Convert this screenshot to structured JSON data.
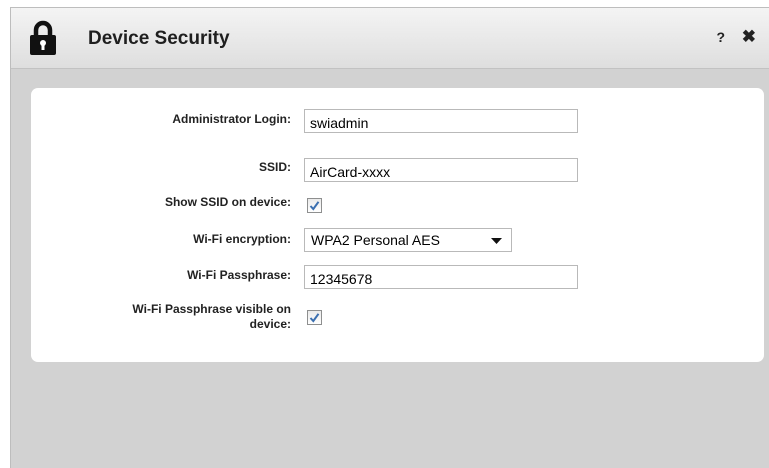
{
  "window": {
    "title": "Device Security",
    "help_label": "?",
    "close_label": "✖"
  },
  "icons": {
    "title_icon": "lock-icon",
    "help": "help-icon",
    "close": "close-icon",
    "checkbox_mark": "check-icon",
    "dropdown": "chevron-down-icon"
  },
  "form": {
    "admin_login": {
      "label": "Administrator Login:",
      "value": "swiadmin"
    },
    "ssid": {
      "label": "SSID:",
      "value": "AirCard-xxxx"
    },
    "show_ssid": {
      "label": "Show SSID on device:",
      "checked": true
    },
    "encryption": {
      "label": "Wi-Fi encryption:",
      "selected": "WPA2 Personal AES"
    },
    "passphrase": {
      "label": "Wi-Fi Passphrase:",
      "value": "12345678"
    },
    "passphrase_visible": {
      "label_line1": "Wi-Fi Passphrase visible on",
      "label_line2": "device:",
      "checked": true
    }
  },
  "colors": {
    "dialog_bg": "#d2d2d2",
    "panel_bg": "#ffffff",
    "check_color": "#3b6fb0"
  }
}
